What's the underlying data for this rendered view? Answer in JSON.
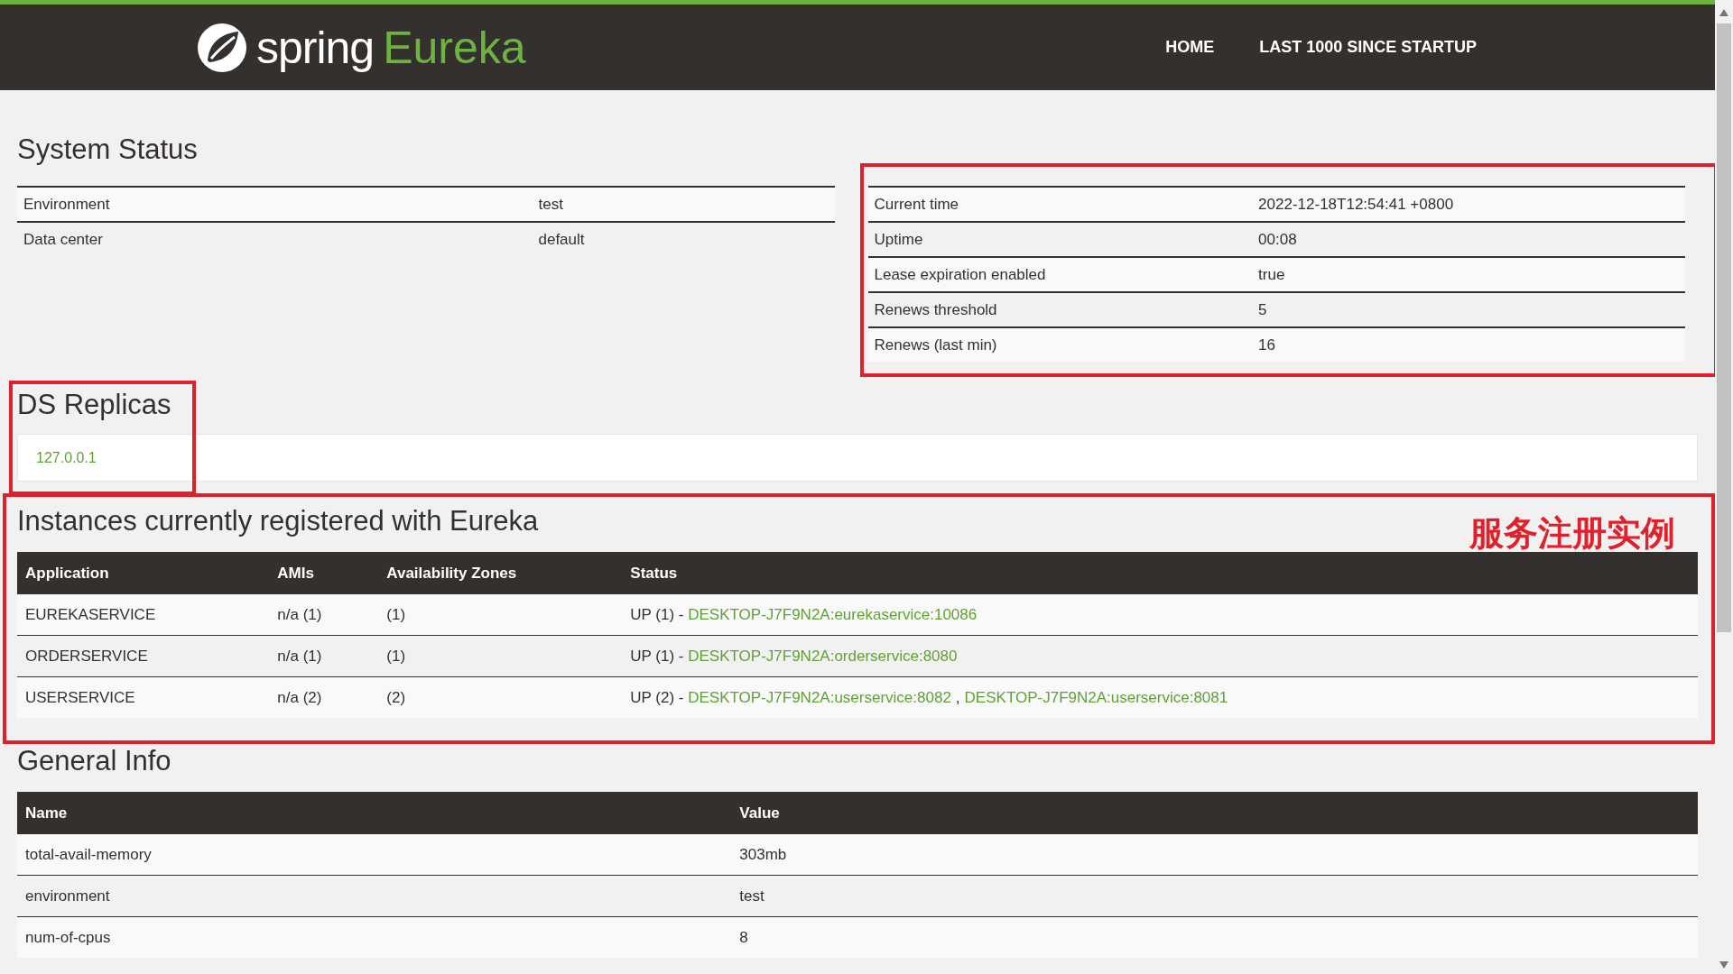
{
  "navbar": {
    "logo_word": "spring",
    "logo_product": "Eureka",
    "links": [
      "HOME",
      "LAST 1000 SINCE STARTUP"
    ]
  },
  "system_status": {
    "title": "System Status",
    "left": [
      {
        "label": "Environment",
        "value": "test"
      },
      {
        "label": "Data center",
        "value": "default"
      }
    ],
    "right": [
      {
        "label": "Current time",
        "value": "2022-12-18T12:54:41 +0800"
      },
      {
        "label": "Uptime",
        "value": "00:08"
      },
      {
        "label": "Lease expiration enabled",
        "value": "true"
      },
      {
        "label": "Renews threshold",
        "value": "5"
      },
      {
        "label": "Renews (last min)",
        "value": "16"
      }
    ]
  },
  "ds_replicas": {
    "title": "DS Replicas",
    "items": [
      "127.0.0.1"
    ]
  },
  "instances": {
    "title": "Instances currently registered with Eureka",
    "columns": [
      "Application",
      "AMIs",
      "Availability Zones",
      "Status"
    ],
    "rows": [
      {
        "application": "EUREKASERVICE",
        "amis": "n/a (1)",
        "zones": "(1)",
        "status": "UP (1) - ",
        "instances": [
          "DESKTOP-J7F9N2A:eurekaservice:10086"
        ]
      },
      {
        "application": "ORDERSERVICE",
        "amis": "n/a (1)",
        "zones": "(1)",
        "status": "UP (1) - ",
        "instances": [
          "DESKTOP-J7F9N2A:orderservice:8080"
        ]
      },
      {
        "application": "USERSERVICE",
        "amis": "n/a (2)",
        "zones": "(2)",
        "status": "UP (2) - ",
        "separator": ",",
        "instances": [
          "DESKTOP-J7F9N2A:userservice:8082",
          "DESKTOP-J7F9N2A:userservice:8081"
        ]
      }
    ]
  },
  "general_info": {
    "title": "General Info",
    "columns": [
      "Name",
      "Value"
    ],
    "rows": [
      {
        "name": "total-avail-memory",
        "value": "303mb"
      },
      {
        "name": "environment",
        "value": "test"
      },
      {
        "name": "num-of-cpus",
        "value": "8"
      }
    ]
  },
  "annotation": {
    "label": "服务注册实例"
  }
}
